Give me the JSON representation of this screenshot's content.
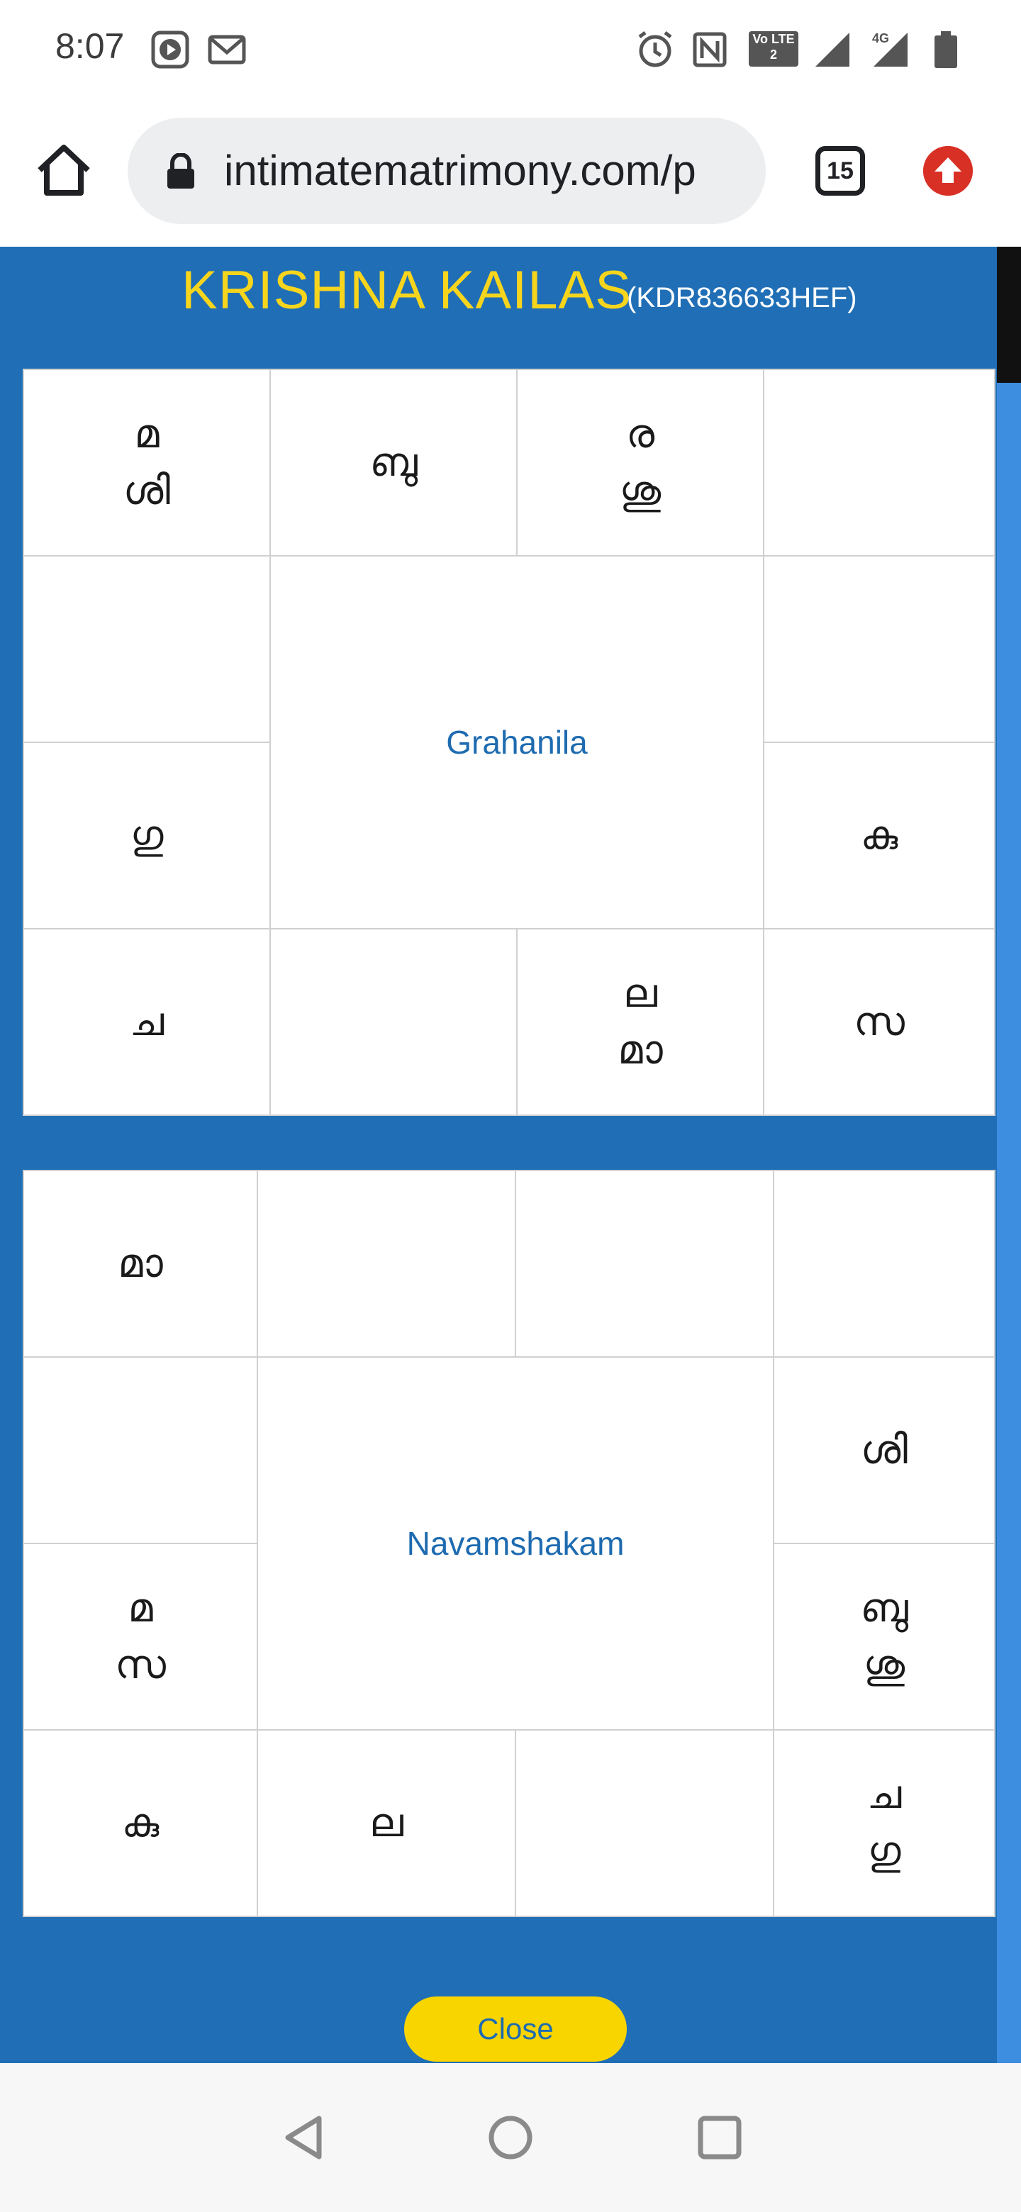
{
  "status_bar": {
    "time": "8:07",
    "icons": [
      "youtube-icon",
      "gmail-icon",
      "alarm-icon",
      "nfc-icon",
      "volte-icon",
      "signal-icon",
      "signal-4g-icon",
      "battery-icon"
    ],
    "volte_label": "Vo LTE 2",
    "network_label": "4G"
  },
  "browser": {
    "url": "intimatematrimony.com/p",
    "tab_count": "15"
  },
  "profile": {
    "name": "KRISHNA KAILAS",
    "id": "(KDR836633HEF)"
  },
  "grahanila": {
    "title": "Grahanila",
    "cells": {
      "r1c1": [
        "മ",
        "ശി"
      ],
      "r1c2": [
        "ബു"
      ],
      "r1c3": [
        "ര",
        "ശു"
      ],
      "r1c4": [],
      "r2c1": [],
      "r2c4": [],
      "r3c1": [
        "ഗു"
      ],
      "r3c4": [
        "കു"
      ],
      "r4c1": [
        "ച"
      ],
      "r4c2": [],
      "r4c3": [
        "ല",
        "മാ"
      ],
      "r4c4": [
        "സ"
      ]
    }
  },
  "navamshakam": {
    "title": "Navamshakam",
    "cells": {
      "r1c1": [
        "മാ"
      ],
      "r1c2": [],
      "r1c3": [],
      "r1c4": [],
      "r2c1": [],
      "r2c4": [
        "ശി"
      ],
      "r3c1": [
        "മ",
        "സ"
      ],
      "r3c4": [
        "ബു",
        "ശു"
      ],
      "r4c1": [
        "കു"
      ],
      "r4c2": [
        "ല"
      ],
      "r4c3": [],
      "r4c4": [
        "ച",
        "ഗു"
      ]
    }
  },
  "actions": {
    "close_label": "Close"
  },
  "colors": {
    "modal_bg": "#206fb6",
    "name_color": "#f7d51d",
    "close_btn": "#f9d500",
    "center_text": "#1e6bb0"
  }
}
